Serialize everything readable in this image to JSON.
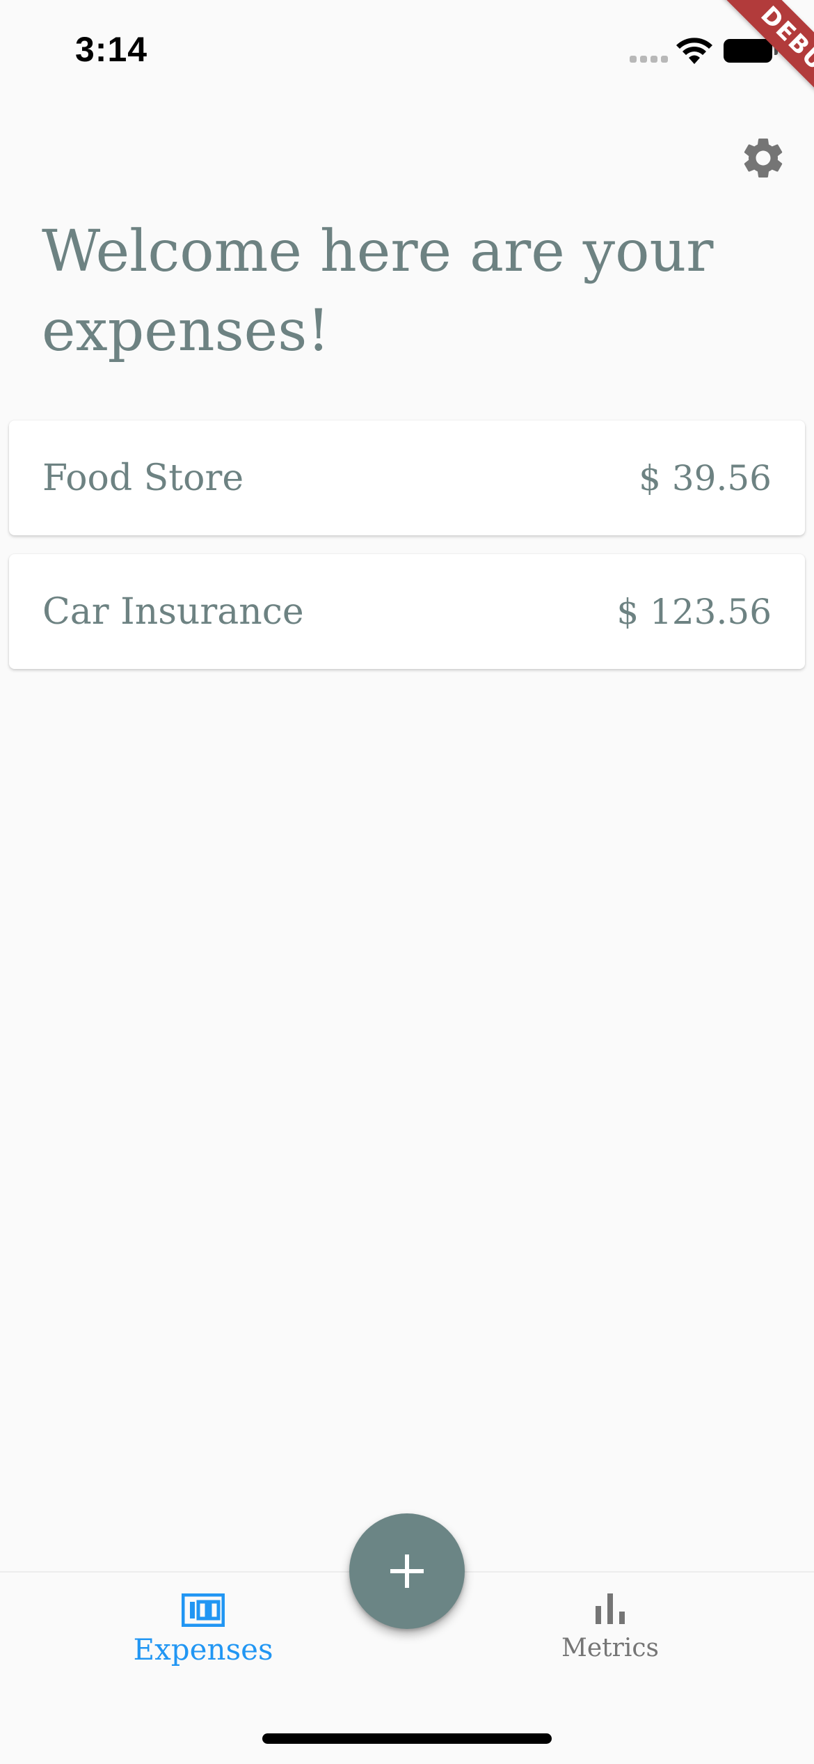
{
  "status_bar": {
    "time": "3:14"
  },
  "debug_banner": {
    "label": "DEBUG"
  },
  "header": {
    "settings_icon": "gear-icon",
    "title": "Welcome here are your expenses!"
  },
  "expenses": [
    {
      "name": "Food Store",
      "amount": "$ 39.56"
    },
    {
      "name": "Car Insurance",
      "amount": "$ 123.56"
    }
  ],
  "fab": {
    "icon": "plus-icon"
  },
  "bottom_nav": {
    "items": [
      {
        "label": "Expenses",
        "icon": "counter-icon",
        "active": true
      },
      {
        "label": "Metrics",
        "icon": "bar-chart-icon",
        "active": false
      }
    ]
  },
  "colors": {
    "text": "#6d8282",
    "fab": "#6b8585",
    "active_nav": "#2196f3",
    "inactive_nav": "#757575",
    "debug_banner": "#b23b3b"
  }
}
